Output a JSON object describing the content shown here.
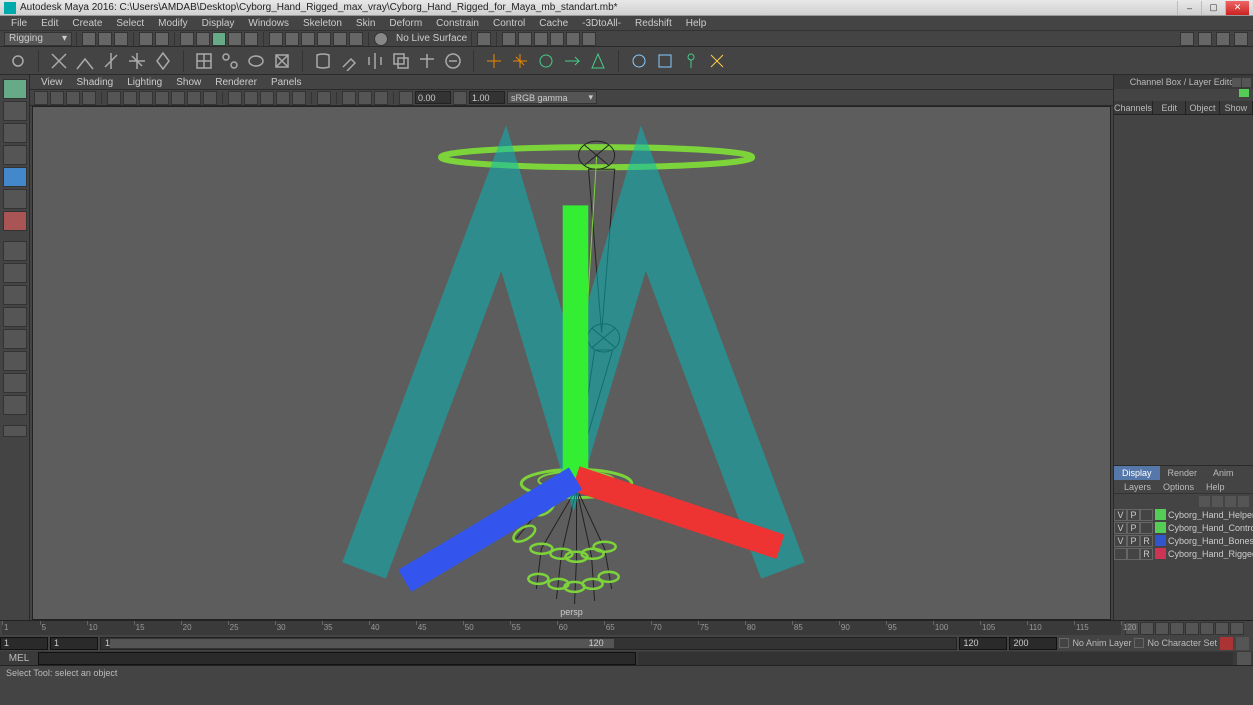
{
  "titlebar": {
    "text": "Autodesk Maya 2016: C:\\Users\\AMDAB\\Desktop\\Cyborg_Hand_Rigged_max_vray\\Cyborg_Hand_Rigged_for_Maya_mb_standart.mb*"
  },
  "menus": {
    "items": [
      "File",
      "Edit",
      "Create",
      "Select",
      "Modify",
      "Display",
      "Windows",
      "Skeleton",
      "Skin",
      "Deform",
      "Constrain",
      "Control",
      "Cache",
      "-3DtoAll-",
      "Redshift",
      "Help"
    ]
  },
  "workspace": {
    "label": "Rigging"
  },
  "shelf": {
    "nolive": "No Live Surface"
  },
  "panel_menu": {
    "items": [
      "View",
      "Shading",
      "Lighting",
      "Show",
      "Renderer",
      "Panels"
    ]
  },
  "panel_toolbar": {
    "near": "0.00",
    "far": "1.00",
    "colorspace": "sRGB gamma"
  },
  "viewport": {
    "camera": "persp"
  },
  "channel_box": {
    "title": "Channel Box / Layer Editor",
    "tabs": [
      "Channels",
      "Edit",
      "Object",
      "Show"
    ]
  },
  "layer_editor": {
    "display_tabs": [
      "Display",
      "Render",
      "Anim"
    ],
    "option_tabs": [
      "Layers",
      "Options",
      "Help"
    ],
    "layers": [
      {
        "v": "V",
        "p": "P",
        "r": "",
        "color": "#55cc55",
        "name": "Cyborg_Hand_Helpers"
      },
      {
        "v": "V",
        "p": "P",
        "r": "",
        "color": "#55cc55",
        "name": "Cyborg_Hand_Control"
      },
      {
        "v": "V",
        "p": "P",
        "r": "R",
        "color": "#3355cc",
        "name": "Cyborg_Hand_Bones"
      },
      {
        "v": "",
        "p": "",
        "r": "R",
        "color": "#cc3355",
        "name": "Cyborg_Hand_Rigged"
      }
    ]
  },
  "timeline": {
    "start": "1",
    "range_start": "1",
    "range_end": "120",
    "end": "200",
    "cur_inner_start": "1",
    "cur_inner_end": "120",
    "anim_layer": "No Anim Layer",
    "char_set": "No Character Set",
    "ticks": [
      1,
      5,
      10,
      15,
      20,
      25,
      30,
      35,
      40,
      45,
      50,
      55,
      60,
      65,
      70,
      75,
      80,
      85,
      90,
      95,
      100,
      105,
      110,
      115,
      120
    ]
  },
  "cmd": {
    "label": "MEL"
  },
  "help_line": {
    "text": "Select Tool: select an object"
  }
}
